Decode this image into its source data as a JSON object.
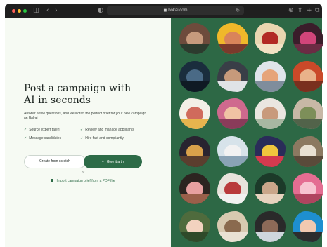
{
  "browser": {
    "url": "bokai.com",
    "icons": {
      "back": "chevron-left-icon",
      "forward": "chevron-right-icon",
      "sidebar": "sidebar-icon",
      "shield": "shield-icon",
      "lock": "lock-icon",
      "reload": "reload-icon",
      "download": "download-icon",
      "share": "share-icon",
      "new_tab": "plus-icon",
      "tabs": "tabs-icon"
    }
  },
  "hero": {
    "headline": "Post a campaign with\nAI in seconds",
    "subtitle": "Answer a few questions, and we'll craft the perfect brief for your new campaign on Bokai."
  },
  "features": [
    {
      "label": "Source expert talent"
    },
    {
      "label": "Review and manage applicants"
    },
    {
      "label": "Message candidates"
    },
    {
      "label": "Hire fast and compliantly"
    }
  ],
  "actions": {
    "create_label": "Create from scratch",
    "ai_label": "Give it a try",
    "or_label": "or",
    "import_label": "Import campaign brief from a PDF file"
  },
  "colors": {
    "brand_green": "#2d6b47",
    "panel_green": "#2d6845",
    "left_bg": "#f6faf3"
  }
}
